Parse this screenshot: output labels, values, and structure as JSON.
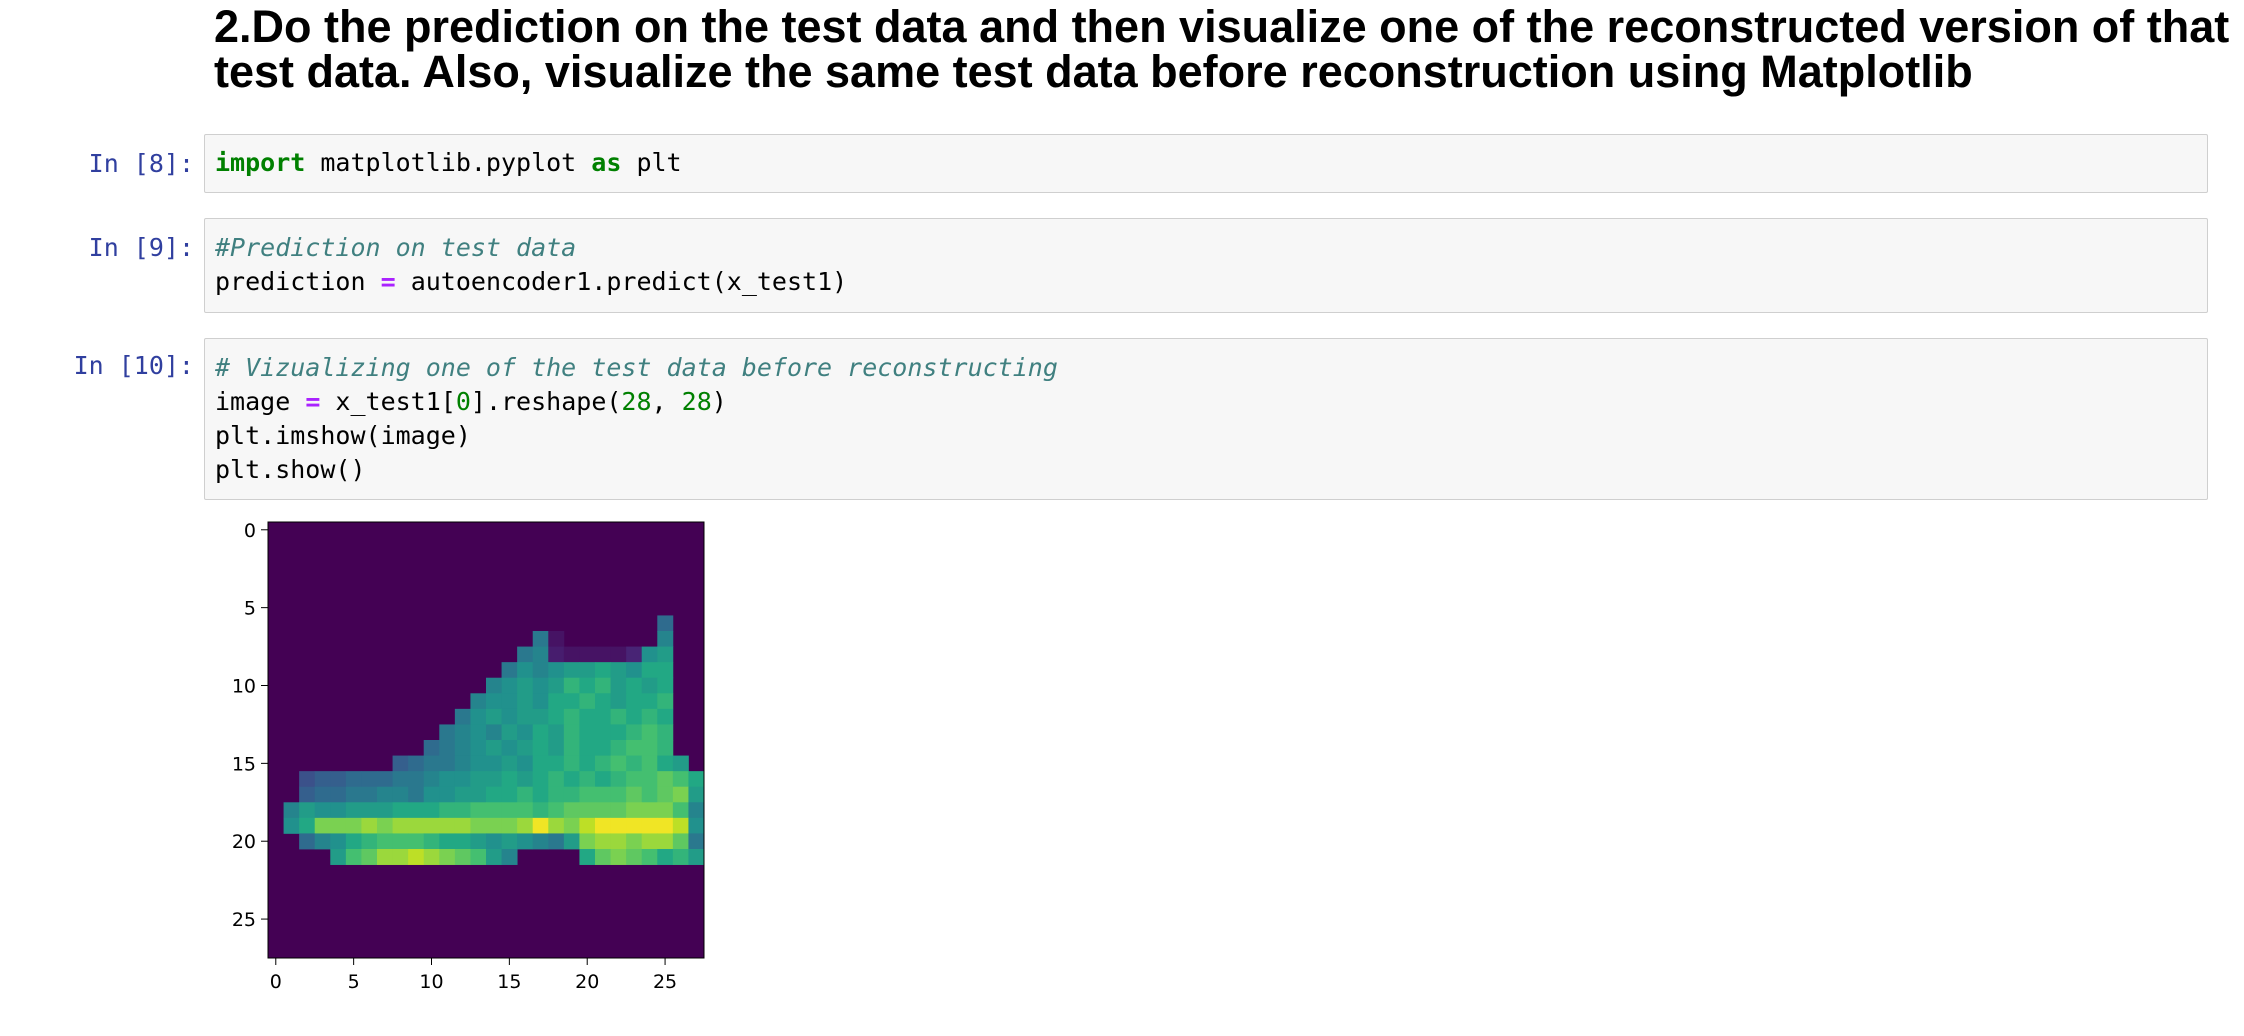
{
  "heading": {
    "line1": "2.Do the prediction on the test data and then visualize one of the reconstructed version of that",
    "line2": "test data. Also, visualize the same test data before reconstruction using Matplotlib"
  },
  "cells": [
    {
      "prompt": "In [8]:",
      "tokens": [
        {
          "t": "kw",
          "v": "import"
        },
        {
          "t": "tx",
          "v": " matplotlib.pyplot "
        },
        {
          "t": "kw",
          "v": "as"
        },
        {
          "t": "tx",
          "v": " plt"
        }
      ]
    },
    {
      "prompt": "In [9]:",
      "comment": "#Prediction on test data",
      "tokens": [
        {
          "t": "tx",
          "v": "prediction "
        },
        {
          "t": "op",
          "v": "="
        },
        {
          "t": "tx",
          "v": " autoencoder1.predict(x_test1)"
        }
      ]
    },
    {
      "prompt": "In [10]:",
      "comment": "# Vizualizing one of the test data before reconstructing",
      "tokens": [
        {
          "t": "tx",
          "v": "image "
        },
        {
          "t": "op",
          "v": "="
        },
        {
          "t": "tx",
          "v": " x_test1["
        },
        {
          "t": "num",
          "v": "0"
        },
        {
          "t": "tx",
          "v": "].reshape("
        },
        {
          "t": "num",
          "v": "28"
        },
        {
          "t": "tx",
          "v": ", "
        },
        {
          "t": "num",
          "v": "28"
        },
        {
          "t": "tx",
          "v": ")"
        }
      ],
      "line3": "plt.imshow(image)",
      "line4": "plt.show()"
    }
  ],
  "chart_data": {
    "type": "heatmap",
    "title": "",
    "xlabel": "",
    "ylabel": "",
    "colormap": "viridis",
    "xlim": [
      -0.5,
      27.5
    ],
    "ylim": [
      27.5,
      -0.5
    ],
    "xticks": [
      0,
      5,
      10,
      15,
      20,
      25
    ],
    "yticks": [
      0,
      5,
      10,
      15,
      20,
      25
    ],
    "rows": 28,
    "cols": 28,
    "nonzero_rows": [
      {
        "row": 6,
        "start": 25,
        "values": [
          0.35
        ]
      },
      {
        "row": 7,
        "start": 17,
        "values": [
          0.4,
          0.05,
          0,
          0,
          0,
          0,
          0,
          0,
          0.45
        ]
      },
      {
        "row": 8,
        "start": 16,
        "values": [
          0.4,
          0.45,
          0.08,
          0.05,
          0.05,
          0.05,
          0.05,
          0.1,
          0.5,
          0.55
        ]
      },
      {
        "row": 9,
        "start": 15,
        "values": [
          0.4,
          0.5,
          0.45,
          0.5,
          0.55,
          0.55,
          0.6,
          0.55,
          0.5,
          0.6,
          0.6
        ]
      },
      {
        "row": 10,
        "start": 14,
        "values": [
          0.45,
          0.5,
          0.55,
          0.5,
          0.55,
          0.65,
          0.6,
          0.65,
          0.55,
          0.6,
          0.55,
          0.6
        ]
      },
      {
        "row": 11,
        "start": 13,
        "values": [
          0.45,
          0.5,
          0.5,
          0.55,
          0.5,
          0.6,
          0.6,
          0.65,
          0.6,
          0.55,
          0.6,
          0.6,
          0.65
        ]
      },
      {
        "row": 12,
        "start": 12,
        "values": [
          0.4,
          0.5,
          0.55,
          0.5,
          0.55,
          0.55,
          0.6,
          0.65,
          0.6,
          0.6,
          0.65,
          0.6,
          0.65,
          0.6
        ]
      },
      {
        "row": 13,
        "start": 11,
        "values": [
          0.4,
          0.45,
          0.5,
          0.45,
          0.55,
          0.5,
          0.6,
          0.55,
          0.65,
          0.6,
          0.6,
          0.6,
          0.65,
          0.7,
          0.65
        ]
      },
      {
        "row": 14,
        "start": 10,
        "values": [
          0.35,
          0.4,
          0.45,
          0.5,
          0.55,
          0.5,
          0.55,
          0.6,
          0.55,
          0.65,
          0.6,
          0.6,
          0.65,
          0.7,
          0.7,
          0.65
        ]
      },
      {
        "row": 15,
        "start": 8,
        "values": [
          0.3,
          0.35,
          0.4,
          0.4,
          0.45,
          0.5,
          0.5,
          0.55,
          0.5,
          0.6,
          0.6,
          0.65,
          0.6,
          0.65,
          0.7,
          0.65,
          0.7,
          0.6,
          0.55
        ]
      },
      {
        "row": 16,
        "start": 2,
        "values": [
          0.25,
          0.3,
          0.3,
          0.35,
          0.35,
          0.35,
          0.4,
          0.4,
          0.45,
          0.5,
          0.5,
          0.55,
          0.55,
          0.6,
          0.55,
          0.6,
          0.65,
          0.6,
          0.65,
          0.6,
          0.65,
          0.7,
          0.7,
          0.75,
          0.7,
          0.6
        ]
      },
      {
        "row": 17,
        "start": 2,
        "values": [
          0.3,
          0.35,
          0.35,
          0.4,
          0.4,
          0.45,
          0.45,
          0.4,
          0.5,
          0.5,
          0.55,
          0.55,
          0.6,
          0.6,
          0.65,
          0.6,
          0.65,
          0.65,
          0.7,
          0.7,
          0.7,
          0.75,
          0.7,
          0.75,
          0.8,
          0.55
        ]
      },
      {
        "row": 18,
        "start": 1,
        "values": [
          0.45,
          0.55,
          0.5,
          0.5,
          0.55,
          0.55,
          0.55,
          0.6,
          0.6,
          0.6,
          0.65,
          0.65,
          0.7,
          0.7,
          0.7,
          0.7,
          0.65,
          0.7,
          0.75,
          0.75,
          0.75,
          0.75,
          0.8,
          0.8,
          0.8,
          0.7,
          0.45
        ]
      },
      {
        "row": 19,
        "start": 1,
        "values": [
          0.5,
          0.6,
          0.8,
          0.8,
          0.8,
          0.85,
          0.8,
          0.85,
          0.85,
          0.85,
          0.85,
          0.85,
          0.8,
          0.8,
          0.8,
          0.85,
          0.98,
          0.85,
          0.8,
          0.9,
          0.98,
          0.98,
          0.98,
          0.98,
          0.98,
          0.9,
          0.5
        ]
      },
      {
        "row": 20,
        "start": 2,
        "values": [
          0.35,
          0.45,
          0.5,
          0.6,
          0.65,
          0.7,
          0.7,
          0.7,
          0.65,
          0.6,
          0.6,
          0.55,
          0.5,
          0.55,
          0.5,
          0.45,
          0.4,
          0.55,
          0.8,
          0.85,
          0.85,
          0.8,
          0.85,
          0.85,
          0.75,
          0.4
        ]
      },
      {
        "row": 21,
        "start": 4,
        "values": [
          0.55,
          0.7,
          0.75,
          0.85,
          0.85,
          0.9,
          0.85,
          0.8,
          0.75,
          0.7,
          0.55,
          0.45,
          0,
          0,
          0,
          0,
          0.6,
          0.75,
          0.8,
          0.75,
          0.7,
          0.6,
          0.65,
          0.55
        ]
      }
    ]
  }
}
